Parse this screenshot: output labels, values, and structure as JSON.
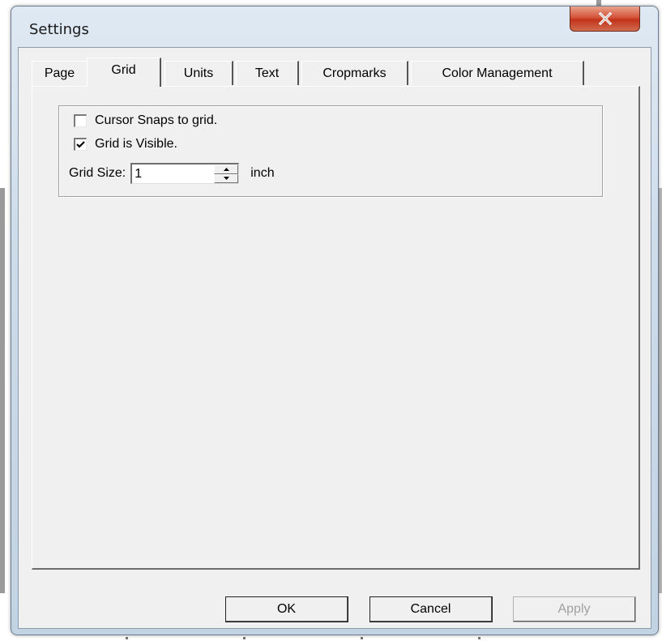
{
  "window": {
    "title": "Settings"
  },
  "tabs": [
    {
      "label": "Page",
      "active": false
    },
    {
      "label": "Grid",
      "active": true
    },
    {
      "label": "Units",
      "active": false
    },
    {
      "label": "Text",
      "active": false
    },
    {
      "label": "Cropmarks",
      "active": false
    },
    {
      "label": "Color Management",
      "active": false
    }
  ],
  "grid": {
    "snap_label": "Cursor Snaps to grid.",
    "snap_checked": false,
    "visible_label": "Grid is Visible.",
    "visible_checked": true,
    "size_label": "Grid Size:",
    "size_value": "1",
    "size_unit": "inch"
  },
  "buttons": {
    "ok": "OK",
    "cancel": "Cancel",
    "apply": "Apply"
  },
  "icons": {
    "close": "close-icon",
    "check": "checkmark-icon",
    "spin_up": "spin-up-icon",
    "spin_down": "spin-down-icon"
  }
}
